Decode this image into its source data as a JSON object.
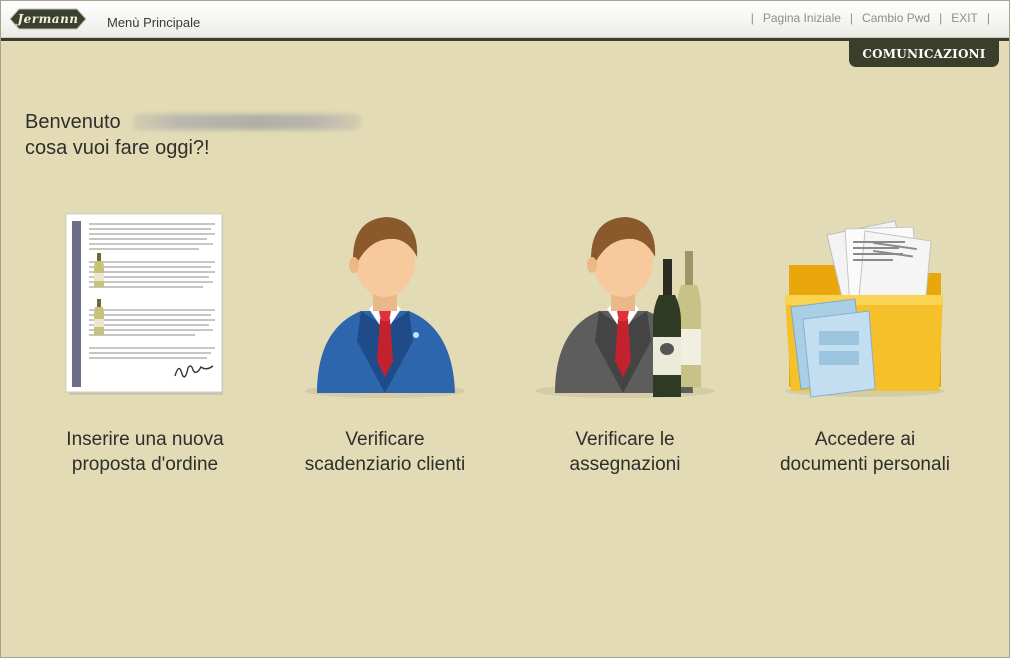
{
  "header": {
    "logo_text": "Jermann",
    "menu_title": "Menù Principale",
    "links": [
      "Pagina Iniziale",
      "Cambio Pwd",
      "EXIT"
    ],
    "separator": "|"
  },
  "communications_tab": "COMUNICAZIONI",
  "welcome": {
    "greeting": "Benvenuto",
    "question": "cosa vuoi fare oggi?!"
  },
  "tiles": [
    {
      "icon": "document-order-icon",
      "label_line1": "Inserire una nuova",
      "label_line2": "proposta d'ordine"
    },
    {
      "icon": "businessman-blue-icon",
      "label_line1": "Verificare",
      "label_line2": "scadenziario clienti"
    },
    {
      "icon": "businessman-wine-icon",
      "label_line1": "Verificare le",
      "label_line2": "assegnazioni"
    },
    {
      "icon": "folder-documents-icon",
      "label_line1": "Accedere ai",
      "label_line2": "documenti personali"
    }
  ],
  "colors": {
    "background": "#e2dbb6",
    "header_dark": "#3a3e2c",
    "tab": "#3a3f2b"
  }
}
